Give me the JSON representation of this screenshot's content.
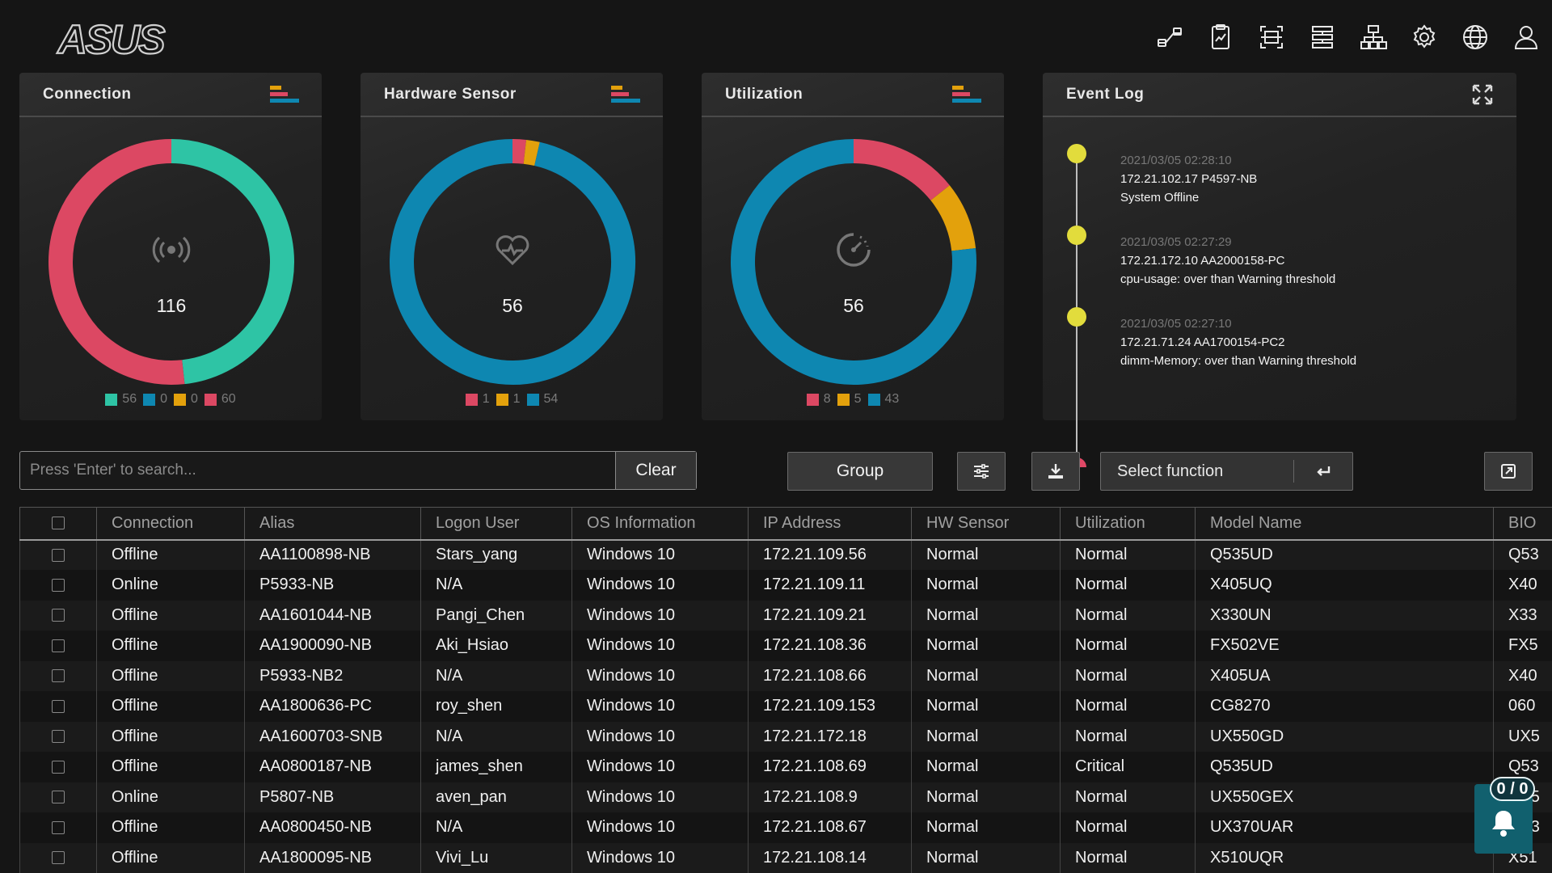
{
  "header": {
    "logo_text": "ASUS",
    "icons": [
      "connect-icon",
      "report-icon",
      "scan-icon",
      "server-list-icon",
      "network-topology-icon",
      "settings-gear-icon",
      "globe-icon",
      "user-icon"
    ]
  },
  "widgets": {
    "connection": {
      "title": "Connection",
      "center_value": "116",
      "center_icon": "broadcast-icon",
      "legend": [
        {
          "color": "#2ec4a5",
          "value": "56"
        },
        {
          "color": "#0e87b1",
          "value": "0"
        },
        {
          "color": "#e3a10c",
          "value": "0"
        },
        {
          "color": "#dc4863",
          "value": "60"
        }
      ],
      "segments": [
        {
          "color": "#2ec4a5",
          "value": 56
        },
        {
          "color": "#dc4863",
          "value": 60
        }
      ]
    },
    "hardware_sensor": {
      "title": "Hardware Sensor",
      "center_value": "56",
      "center_icon": "heartbeat-icon",
      "legend": [
        {
          "color": "#dc4863",
          "value": "1"
        },
        {
          "color": "#e3a10c",
          "value": "1"
        },
        {
          "color": "#0e87b1",
          "value": "54"
        }
      ],
      "segments": [
        {
          "color": "#dc4863",
          "value": 1
        },
        {
          "color": "#e3a10c",
          "value": 1
        },
        {
          "color": "#0e87b1",
          "value": 54
        }
      ]
    },
    "utilization": {
      "title": "Utilization",
      "center_value": "56",
      "center_icon": "gauge-icon",
      "legend": [
        {
          "color": "#dc4863",
          "value": "8"
        },
        {
          "color": "#e3a10c",
          "value": "5"
        },
        {
          "color": "#0e87b1",
          "value": "43"
        }
      ],
      "segments": [
        {
          "color": "#dc4863",
          "value": 8
        },
        {
          "color": "#e3a10c",
          "value": 5
        },
        {
          "color": "#0e87b1",
          "value": 43
        }
      ]
    },
    "event_log": {
      "title": "Event Log",
      "events": [
        {
          "time": "2021/03/05 02:28:10",
          "line1": "172.21.102.17 P4597-NB",
          "line2": "System Offline"
        },
        {
          "time": "2021/03/05 02:27:29",
          "line1": "172.21.172.10 AA2000158-PC",
          "line2": "cpu-usage: over than Warning threshold"
        },
        {
          "time": "2021/03/05 02:27:10",
          "line1": "172.21.71.24 AA1700154-PC2",
          "line2": "dimm-Memory: over than Warning threshold"
        }
      ]
    }
  },
  "toolbar": {
    "search_placeholder": "Press 'Enter' to search...",
    "clear_label": "Clear",
    "group_label": "Group",
    "select_function_label": "Select function"
  },
  "table": {
    "columns": [
      "Connection",
      "Alias",
      "Logon User",
      "OS Information",
      "IP Address",
      "HW Sensor",
      "Utilization",
      "Model Name",
      "BIO"
    ],
    "rows": [
      [
        "Offline",
        "AA1100898-NB",
        "Stars_yang",
        "Windows 10",
        "172.21.109.56",
        "Normal",
        "Normal",
        "Q535UD",
        "Q53"
      ],
      [
        "Online",
        "P5933-NB",
        "N/A",
        "Windows 10",
        "172.21.109.11",
        "Normal",
        "Normal",
        "X405UQ",
        "X40"
      ],
      [
        "Offline",
        "AA1601044-NB",
        "Pangi_Chen",
        "Windows 10",
        "172.21.109.21",
        "Normal",
        "Normal",
        "X330UN",
        "X33"
      ],
      [
        "Offline",
        "AA1900090-NB",
        "Aki_Hsiao",
        "Windows 10",
        "172.21.108.36",
        "Normal",
        "Normal",
        "FX502VE",
        "FX5"
      ],
      [
        "Offline",
        "P5933-NB2",
        "N/A",
        "Windows 10",
        "172.21.108.66",
        "Normal",
        "Normal",
        "X405UA",
        "X40"
      ],
      [
        "Offline",
        "AA1800636-PC",
        "roy_shen",
        "Windows 10",
        "172.21.109.153",
        "Normal",
        "Normal",
        "CG8270",
        "060"
      ],
      [
        "Offline",
        "AA1600703-SNB",
        "N/A",
        "Windows 10",
        "172.21.172.18",
        "Normal",
        "Normal",
        "UX550GD",
        "UX5"
      ],
      [
        "Offline",
        "AA0800187-NB",
        "james_shen",
        "Windows 10",
        "172.21.108.69",
        "Normal",
        "Critical",
        "Q535UD",
        "Q53"
      ],
      [
        "Online",
        "P5807-NB",
        "aven_pan",
        "Windows 10",
        "172.21.108.9",
        "Normal",
        "Normal",
        "UX550GEX",
        "UX5"
      ],
      [
        "Offline",
        "AA0800450-NB",
        "N/A",
        "Windows 10",
        "172.21.108.67",
        "Normal",
        "Normal",
        "UX370UAR",
        "UX3"
      ],
      [
        "Offline",
        "AA1800095-NB",
        "Vivi_Lu",
        "Windows 10",
        "172.21.108.14",
        "Normal",
        "Normal",
        "X510UQR",
        "X51"
      ]
    ]
  },
  "notification": {
    "badge": "0 / 0",
    "icon": "bell-icon"
  },
  "colors": {
    "green": "#2ec4a5",
    "blue": "#0e87b1",
    "orange": "#e3a10c",
    "red": "#dc4863",
    "event_dot": "#e2dc3c"
  }
}
